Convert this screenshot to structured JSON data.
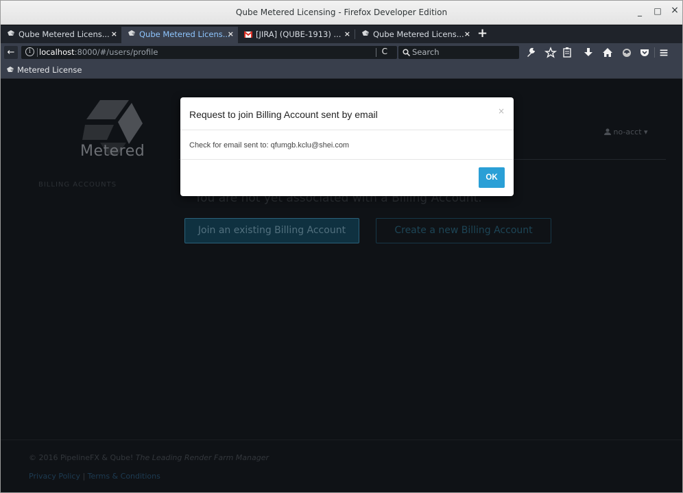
{
  "window": {
    "title": "Qube Metered Licensing - Firefox Developer Edition",
    "minimize": "_",
    "maximize": "□",
    "close": "×"
  },
  "tabs": [
    {
      "label": "Qube Metered Licens...",
      "close": "×",
      "active": false,
      "icon": "qube-favicon"
    },
    {
      "label": "Qube Metered Licens...",
      "close": "×",
      "active": true,
      "icon": "qube-favicon"
    },
    {
      "label": "[JIRA] (QUBE-1913) ...",
      "close": "×",
      "active": false,
      "icon": "gmail-favicon"
    },
    {
      "label": "Qube Metered Licens...",
      "close": "×",
      "active": false,
      "icon": "qube-favicon"
    }
  ],
  "new_tab": "+",
  "navbar": {
    "back": "←",
    "url_host": "localhost",
    "url_rest": ":8000/#/users/profile",
    "reload": "C",
    "search_icon": "🔍",
    "search_placeholder": "Search",
    "toolbar_icons": [
      "wrench-icon",
      "star-icon",
      "reader-icon",
      "download-icon",
      "home-icon",
      "addon-icon",
      "pocket-icon",
      "menu-icon"
    ]
  },
  "bookmarks": {
    "item": "Metered License"
  },
  "page": {
    "logo_text": "Metered",
    "side_billing": "BILLING ACCOUNTS",
    "user_menu": "no-acct ▾",
    "not_associated": "You are not yet associated with a Billing Account.",
    "join_button": "Join an existing Billing Account",
    "create_button": "Create a new Billing Account",
    "copyright_prefix": "© 2016 PipelineFX & Qube! ",
    "copyright_tagline": "The Leading Render Farm Manager",
    "privacy": "Privacy Policy",
    "separator": " | ",
    "terms": "Terms & Conditions"
  },
  "modal": {
    "title": "Request to join Billing Account sent by email",
    "close": "×",
    "body": "Check for email sent to: qfumgb.kclu@shei.com",
    "ok": "OK"
  },
  "colors": {
    "accent": "#2a9fd6",
    "page_bg": "#0f1216",
    "chrome_dark": "#393f4c"
  }
}
